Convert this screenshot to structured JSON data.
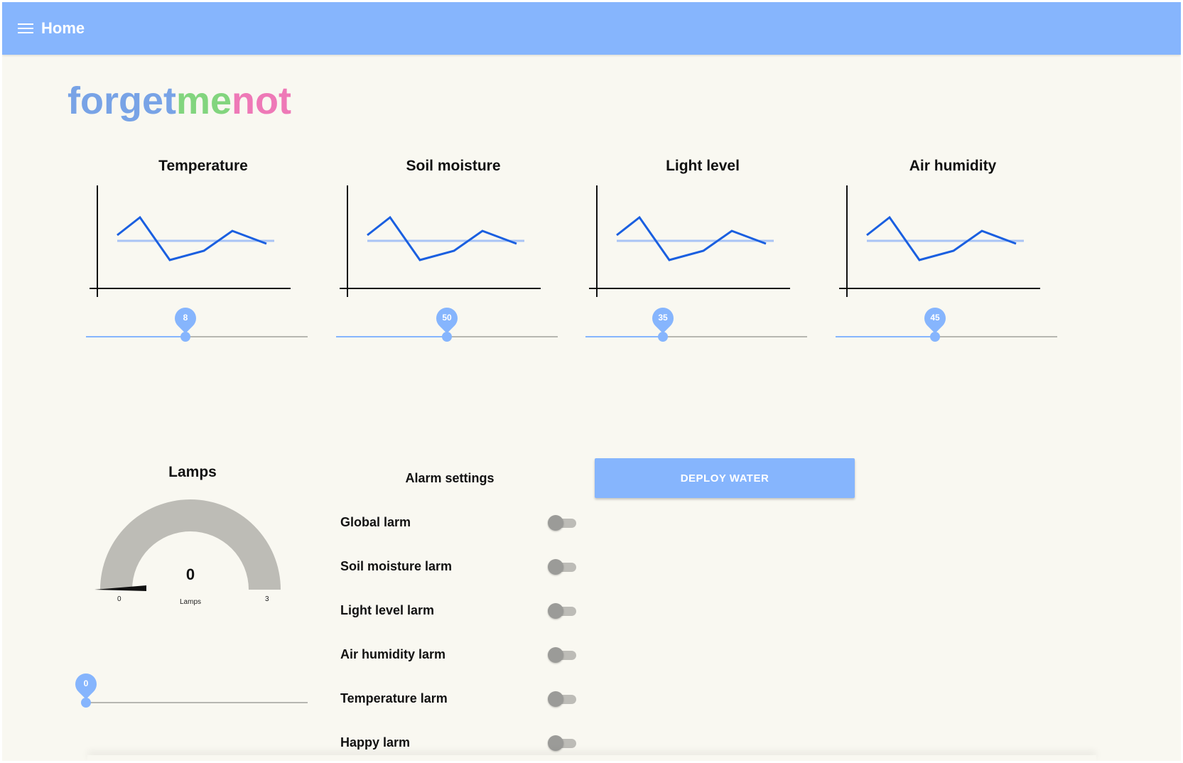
{
  "app_bar": {
    "menu_icon": "menu-icon",
    "title": "Home"
  },
  "logo": {
    "part1": "forget",
    "part2": "me",
    "part3": "not",
    "colors": [
      "#78a3e6",
      "#82d57e",
      "#ee79b7"
    ]
  },
  "accent_color": "#86b5fd",
  "sensors": [
    {
      "title": "Temperature",
      "slider_value": 8,
      "slider_fraction": 0.45
    },
    {
      "title": "Soil moisture",
      "slider_value": 50,
      "slider_fraction": 0.5
    },
    {
      "title": "Light level",
      "slider_value": 35,
      "slider_fraction": 0.35
    },
    {
      "title": "Air humidity",
      "slider_value": 45,
      "slider_fraction": 0.45
    }
  ],
  "sparkline": {
    "line_color": "#1a5fe0",
    "threshold_color": "#a9c4f5"
  },
  "lamps": {
    "title": "Lamps",
    "gauge_value": "0",
    "gauge_label": "Lamps",
    "gauge_min": "0",
    "gauge_max": "3",
    "slider_value": 0,
    "slider_fraction": 0
  },
  "alarms": {
    "title": "Alarm settings",
    "items": [
      {
        "label": "Global larm",
        "on": false
      },
      {
        "label": "Soil moisture larm",
        "on": false
      },
      {
        "label": "Light level larm",
        "on": false
      },
      {
        "label": "Air humidity larm",
        "on": false
      },
      {
        "label": "Temperature larm",
        "on": false
      },
      {
        "label": "Happy larm",
        "on": false
      }
    ]
  },
  "deploy_button": {
    "label": "DEPLOY WATER"
  }
}
